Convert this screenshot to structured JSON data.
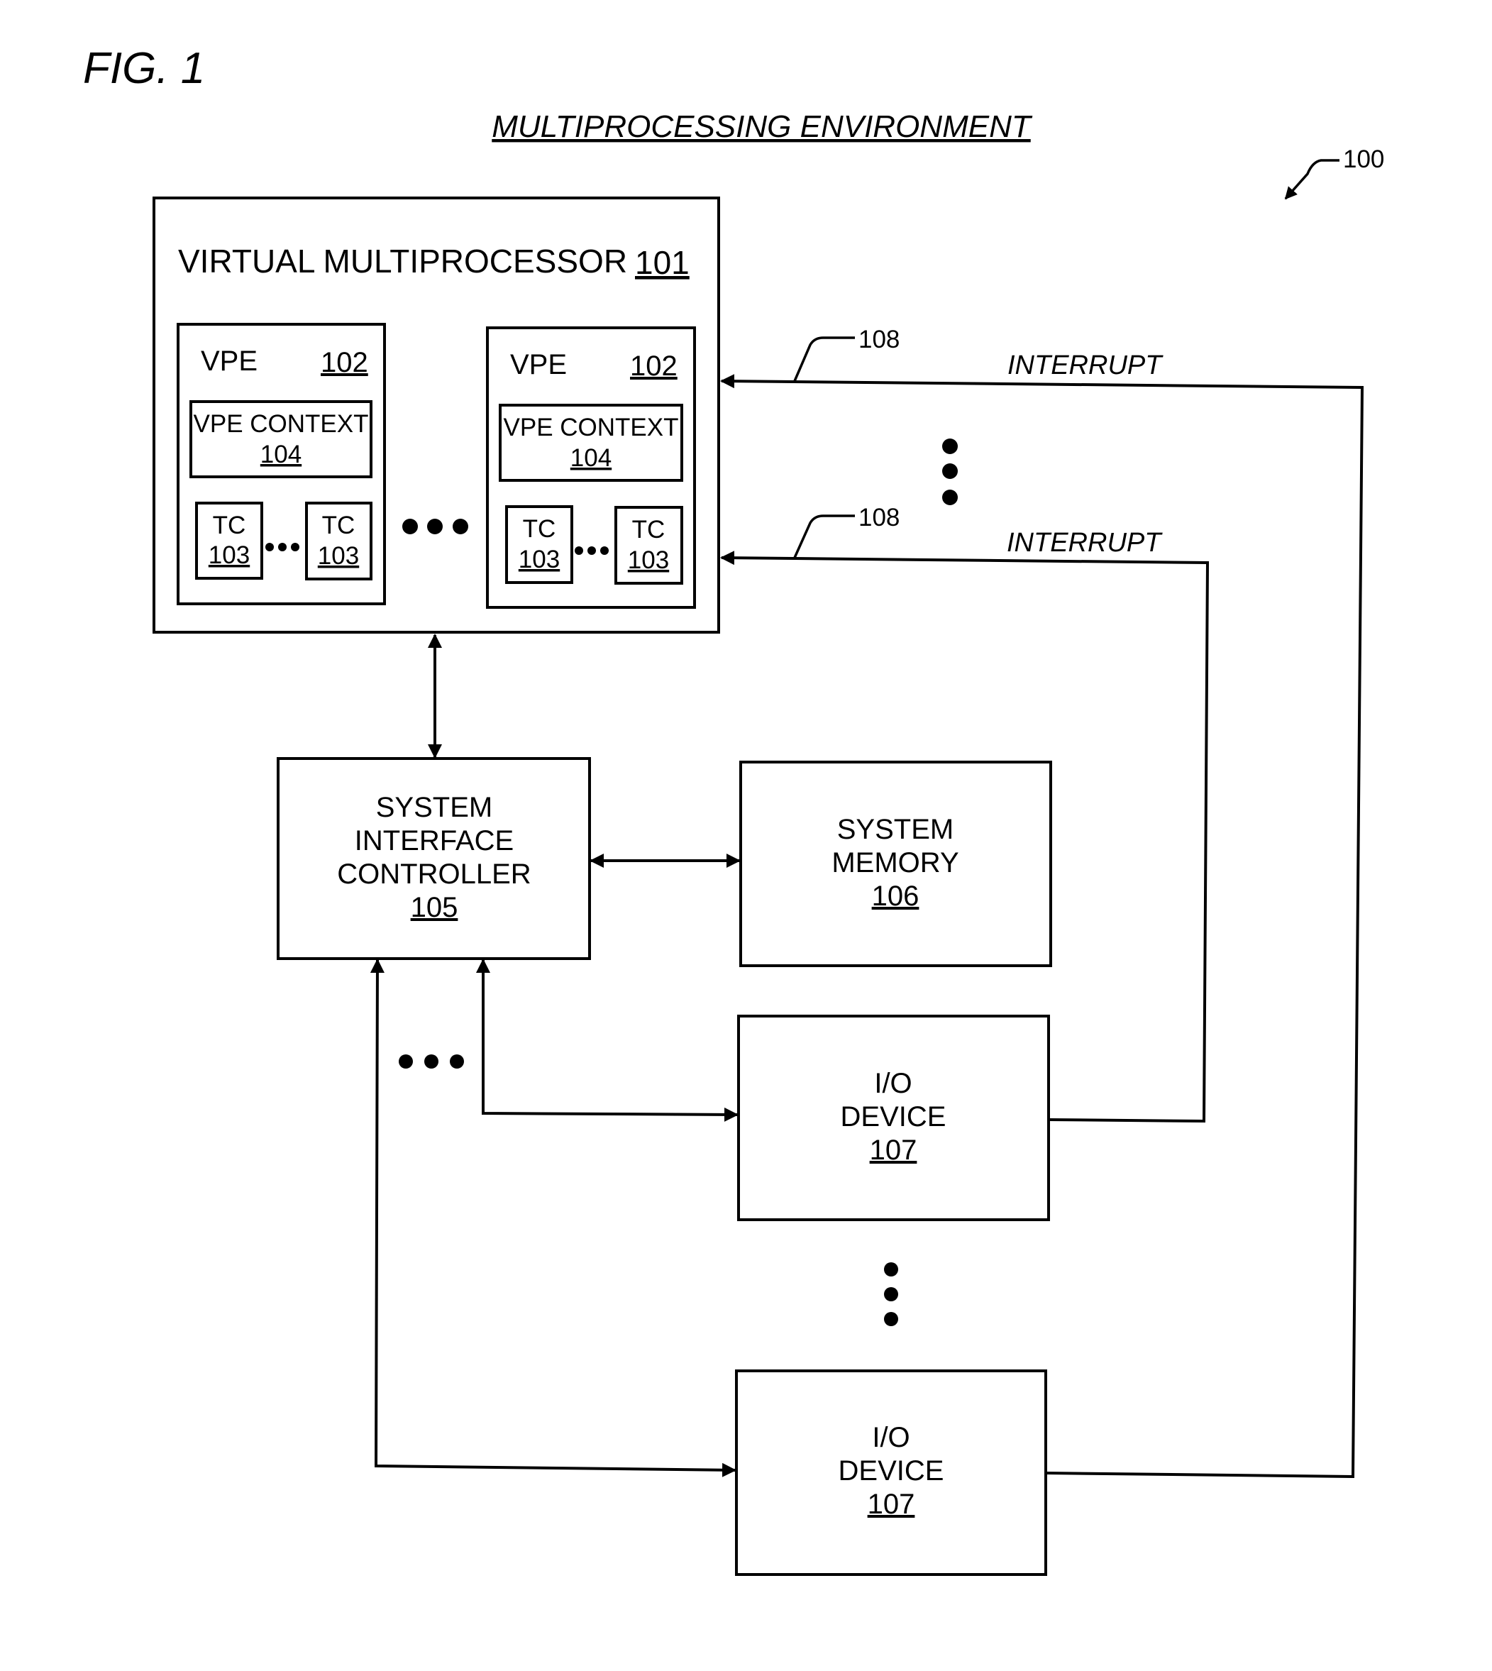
{
  "figure": {
    "label": "FIG. 1",
    "title": "MULTIPROCESSING ENVIRONMENT",
    "ref": "100"
  },
  "virtual_multiprocessor": {
    "label": "VIRTUAL MULTIPROCESSOR",
    "ref": "101",
    "vpes": [
      {
        "label": "VPE",
        "ref": "102",
        "context": {
          "label": "VPE CONTEXT",
          "ref": "104"
        },
        "tcs": [
          {
            "label": "TC",
            "ref": "103"
          },
          {
            "label": "TC",
            "ref": "103"
          }
        ]
      },
      {
        "label": "VPE",
        "ref": "102",
        "context": {
          "label": "VPE CONTEXT",
          "ref": "104"
        },
        "tcs": [
          {
            "label": "TC",
            "ref": "103"
          },
          {
            "label": "TC",
            "ref": "103"
          }
        ]
      }
    ]
  },
  "system_interface_controller": {
    "lines": [
      "SYSTEM",
      "INTERFACE",
      "CONTROLLER"
    ],
    "ref": "105"
  },
  "system_memory": {
    "lines": [
      "SYSTEM",
      "MEMORY"
    ],
    "ref": "106"
  },
  "io_devices": [
    {
      "lines": [
        "I/O",
        "DEVICE"
      ],
      "ref": "107"
    },
    {
      "lines": [
        "I/O",
        "DEVICE"
      ],
      "ref": "107"
    }
  ],
  "interrupts": [
    {
      "label": "INTERRUPT",
      "ref": "108"
    },
    {
      "label": "INTERRUPT",
      "ref": "108"
    }
  ]
}
